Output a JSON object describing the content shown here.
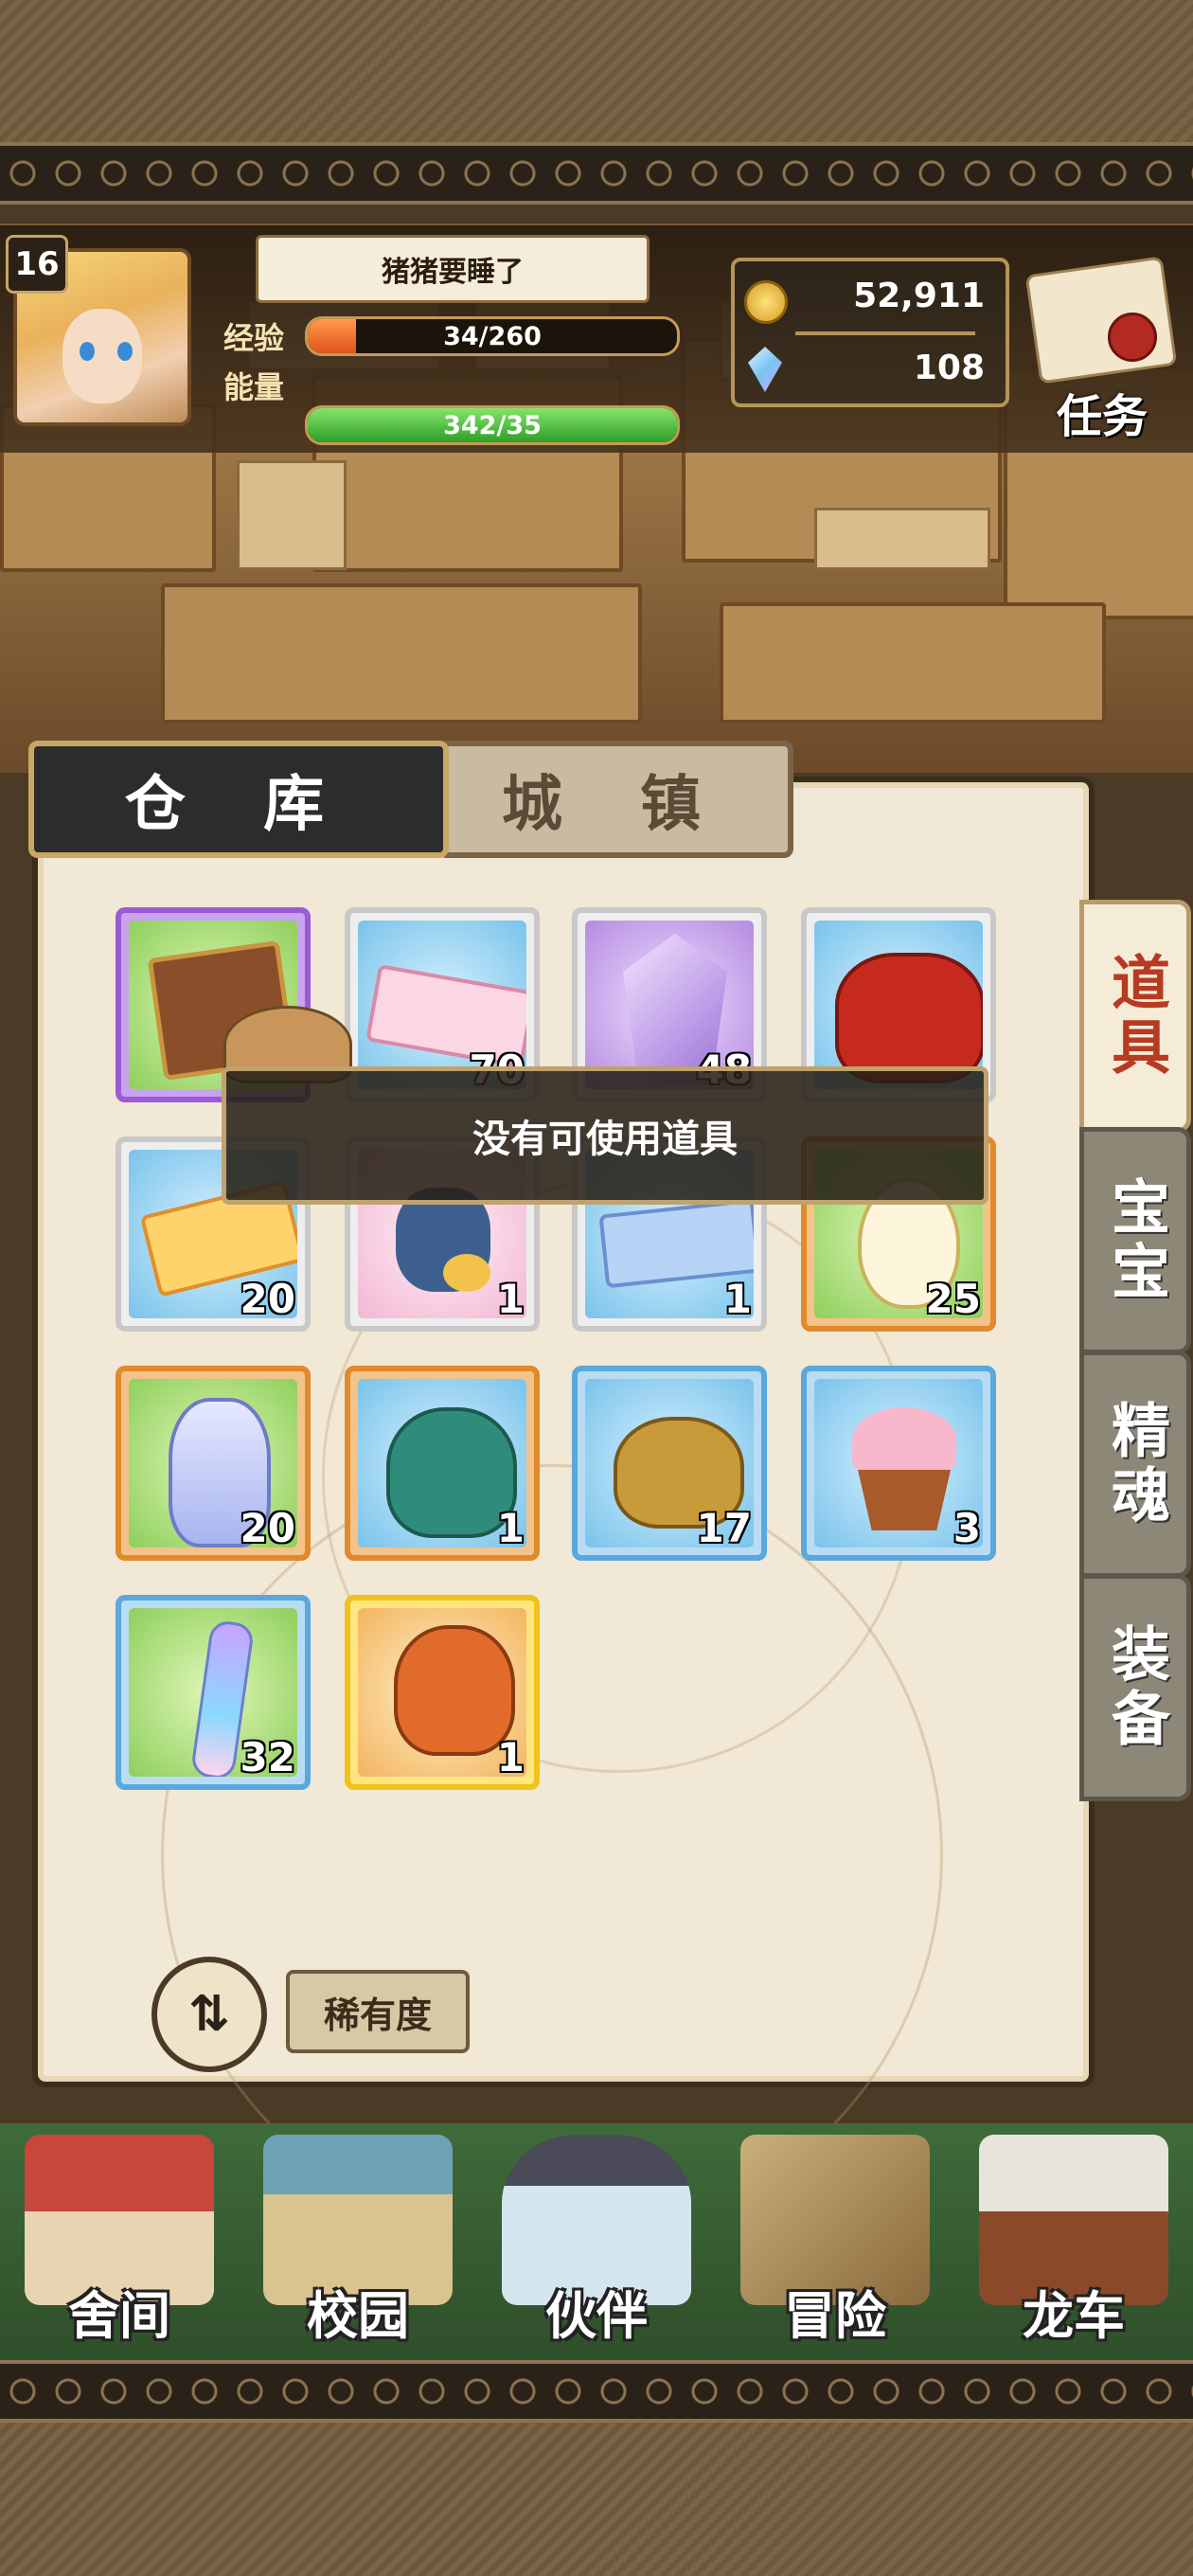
{
  "header": {
    "level": "16",
    "player_name": "猪猪要睡了",
    "exp_label": "经验",
    "exp_value": "34/260",
    "exp_progress": 0.13,
    "energy_label": "能量",
    "energy_value": "342/35",
    "energy_progress": 1.0,
    "gold": "52,911",
    "gems": "108",
    "quest_label": "任务"
  },
  "tabs": {
    "warehouse": "仓 库",
    "town": "城 镇"
  },
  "side_tabs": {
    "items": "道具",
    "baby": "宝宝",
    "spirit": "精魂",
    "equipment": "装备"
  },
  "toast": "没有可使用道具",
  "items": [
    {
      "name": "magic-book",
      "count": "",
      "rarity": "purple"
    },
    {
      "name": "ticket",
      "count": "70",
      "rarity": "white"
    },
    {
      "name": "crystal-shard",
      "count": "48",
      "rarity": "white"
    },
    {
      "name": "lucky-bag",
      "count": "",
      "rarity": "white"
    },
    {
      "name": "winged-ticket",
      "count": "20",
      "rarity": "white"
    },
    {
      "name": "plush-doll",
      "count": "1",
      "rarity": "white"
    },
    {
      "name": "star-ticket",
      "count": "1",
      "rarity": "white"
    },
    {
      "name": "clock-egg",
      "count": "25",
      "rarity": "orange"
    },
    {
      "name": "potion-bottle",
      "count": "20",
      "rarity": "orange"
    },
    {
      "name": "coin-bag-green",
      "count": "1",
      "rarity": "orange"
    },
    {
      "name": "gold-bag",
      "count": "17",
      "rarity": "blue"
    },
    {
      "name": "cupcake",
      "count": "3",
      "rarity": "blue"
    },
    {
      "name": "star-vial",
      "count": "32",
      "rarity": "blue"
    },
    {
      "name": "gift-pouch",
      "count": "1",
      "rarity": "gold"
    }
  ],
  "sort": {
    "toggle_label": "⇅",
    "rarity_label": "稀有度"
  },
  "nav": [
    {
      "label": "舍间"
    },
    {
      "label": "校园"
    },
    {
      "label": "伙伴"
    },
    {
      "label": "冒险"
    },
    {
      "label": "龙车"
    }
  ]
}
